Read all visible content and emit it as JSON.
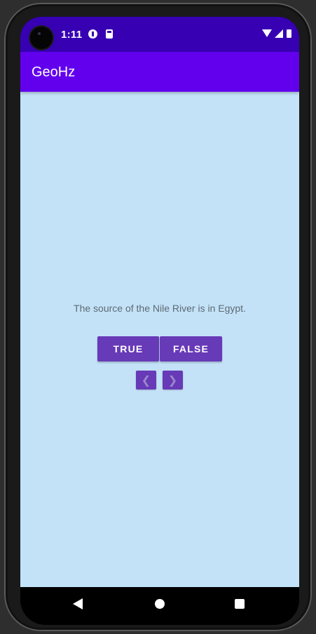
{
  "status_bar": {
    "time": "1:11",
    "icons": [
      "notification-icon",
      "sd-card-icon",
      "wifi-icon",
      "signal-icon",
      "battery-icon"
    ]
  },
  "app_bar": {
    "title": "GeoHz"
  },
  "quiz": {
    "question": "The source of the Nile River is in Egypt.",
    "true_label": "TRUE",
    "false_label": "FALSE",
    "prev_label": "❮",
    "next_label": "❯"
  },
  "navigation_bar": {
    "icons": [
      "back-icon",
      "home-icon",
      "recents-icon"
    ]
  },
  "colors": {
    "status_bar": "#3700b3",
    "app_bar": "#6200ee",
    "background": "#c3e2f8",
    "button": "#673ab7"
  }
}
